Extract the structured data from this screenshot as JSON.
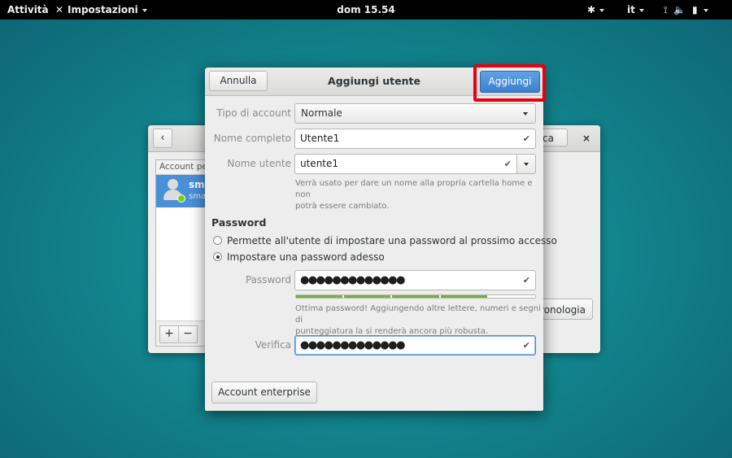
{
  "topbar": {
    "activities": "Attività",
    "app_menu": "Impostazioni",
    "clock": "dom 15.54",
    "language": "it",
    "status_icons": "⟟ 🔈 ▮"
  },
  "background_window": {
    "list_header": "Account per",
    "user_name": "sma",
    "user_sub": "sma",
    "lock_fragment": "ca",
    "cron_fragment": "ronologia",
    "add_symbol": "+",
    "remove_symbol": "−",
    "close_symbol": "×",
    "back_symbol": "‹"
  },
  "dialog": {
    "title": "Aggiungi utente",
    "cancel_label": "Annulla",
    "add_label": "Aggiungi",
    "account_type_label": "Tipo di account",
    "account_type_value": "Normale",
    "full_name_label": "Nome completo",
    "full_name_value": "Utente1",
    "username_label": "Nome utente",
    "username_value": "utente1",
    "username_hint_line1": "Verrà usato per dare un nome alla propria cartella home e non",
    "username_hint_line2": "potrà essere cambiato.",
    "password_section": "Password",
    "radio_next_login": "Permette all'utente di impostare una password al prossimo accesso",
    "radio_now": "Impostare una password adesso",
    "password_label": "Password",
    "password_value": "●●●●●●●●●●●●●",
    "strength_value": 0.8,
    "password_hint_line1": "Ottima password! Aggiungendo altre lettere, numeri e segni di",
    "password_hint_line2": "punteggiatura la si renderà ancora più robusta.",
    "verify_label": "Verifica",
    "verify_value": "●●●●●●●●●●●●●",
    "enterprise_label": "Account enterprise",
    "check_mark": "✔"
  },
  "colors": {
    "accent": "#4a90d9",
    "highlight": "#e8000c",
    "strength": "#73b13b"
  }
}
